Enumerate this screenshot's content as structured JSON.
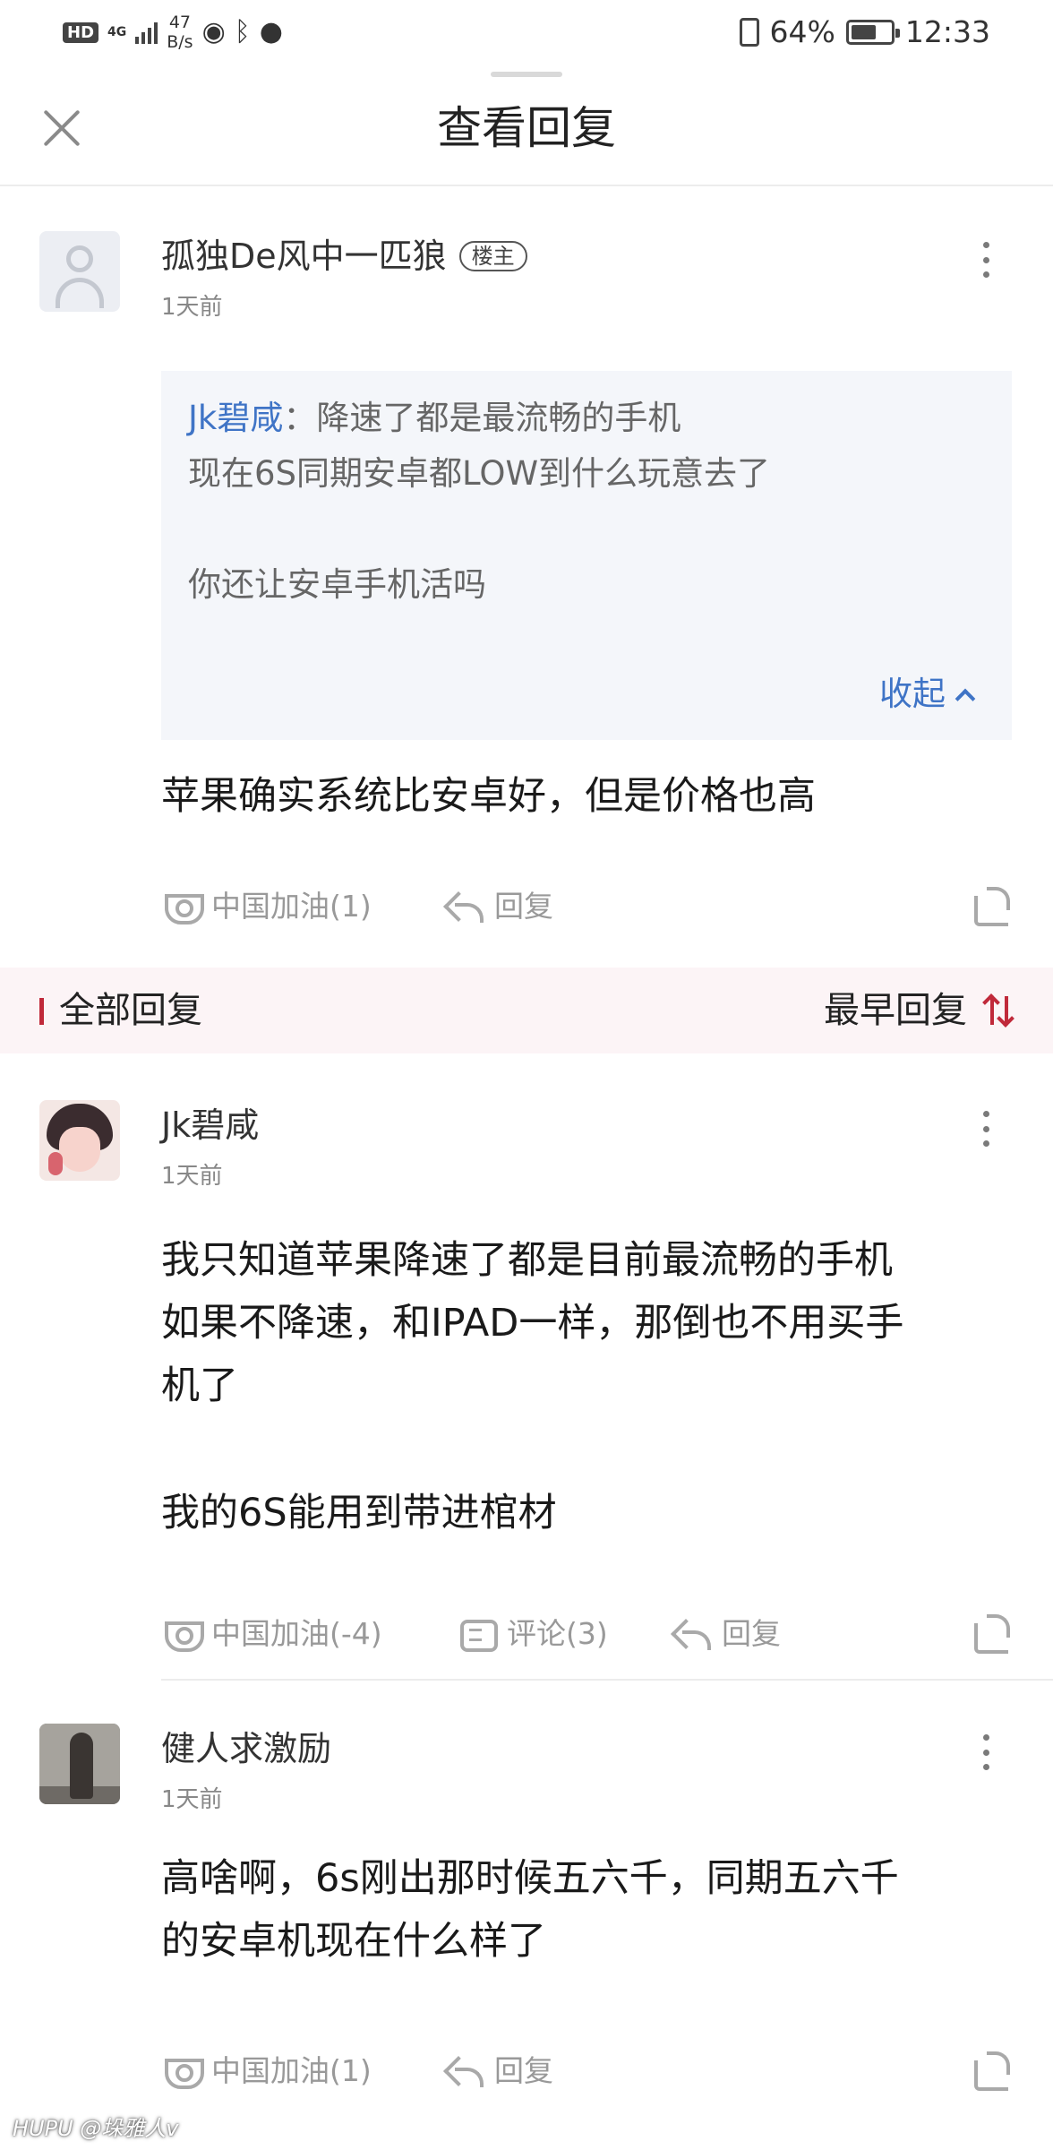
{
  "status_bar": {
    "hd": "HD",
    "network": "4G",
    "speed_value": "47",
    "speed_unit": "B/s",
    "battery_percent": "64%",
    "battery_level": 0.64,
    "time": "12:33",
    "icons": [
      "signal-icon",
      "eye-icon",
      "bluetooth-icon",
      "chat-bubble-icon",
      "vibrate-icon",
      "battery-icon"
    ]
  },
  "header": {
    "title": "查看回复"
  },
  "original_post": {
    "username": "孤独De风中一匹狼",
    "badge": "楼主",
    "time": "1天前",
    "quote": {
      "author": "Jk碧咸",
      "separator": "：",
      "line1": "降速了都是最流畅的手机",
      "line2": "现在6S同期安卓都LOW到什么玩意去了",
      "line3": "你还让安卓手机活吗",
      "collapse_label": "收起"
    },
    "content": [
      "苹果确实系统比安卓好，但是价格也高"
    ],
    "actions": {
      "cheer": "中国加油(1)",
      "reply": "回复"
    }
  },
  "section": {
    "title": "全部回复",
    "sort_label": "最早回复"
  },
  "replies": [
    {
      "username": "Jk碧咸",
      "time": "1天前",
      "content": [
        "我只知道苹果降速了都是目前最流畅的手机",
        "如果不降速，和IPAD一样，那倒也不用买手",
        "机了",
        "",
        "我的6S能用到带进棺材"
      ],
      "actions": {
        "cheer": "中国加油(-4)",
        "comment": "评论(3)",
        "reply": "回复"
      }
    },
    {
      "username": "健人求激励",
      "time": "1天前",
      "content": [
        "高啥啊，6s刚出那时候五六千，同期五六千",
        "的安卓机现在什么样了"
      ],
      "actions": {
        "cheer": "中国加油(1)",
        "reply": "回复"
      }
    }
  ],
  "watermark": "HUPU @垛雅人v"
}
